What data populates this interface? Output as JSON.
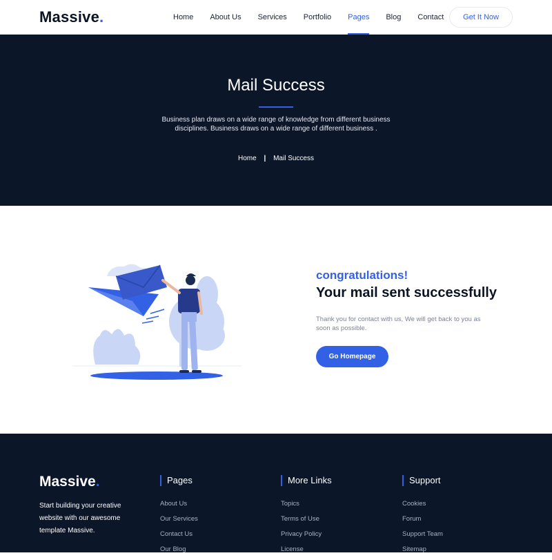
{
  "brand": {
    "name": "Massive",
    "dot": "."
  },
  "nav": {
    "items": [
      {
        "label": "Home"
      },
      {
        "label": "About Us"
      },
      {
        "label": "Services"
      },
      {
        "label": "Portfolio"
      },
      {
        "label": "Pages",
        "active": true
      },
      {
        "label": "Blog"
      },
      {
        "label": "Contact"
      }
    ],
    "cta_label": "Get It Now"
  },
  "hero": {
    "title": "Mail Success",
    "description": "Business plan draws on a wide range of knowledge from different business disciplines. Business draws on a wide range of different business .",
    "breadcrumb": {
      "home": "Home",
      "separator": "|",
      "current": "Mail Success"
    }
  },
  "main": {
    "congrats": "congratulations!",
    "headline": "Your mail sent successfully",
    "message": "Thank you for contact with us, We will get back to you as soon as possible.",
    "button_label": "Go Homepage"
  },
  "footer": {
    "tagline": "Start building your creative website with our awesome template Massive.",
    "columns": [
      {
        "title": "Pages",
        "links": [
          "About Us",
          "Our Services",
          "Contact Us",
          "Our Blog"
        ]
      },
      {
        "title": "More Links",
        "links": [
          "Topics",
          "Terms of Use",
          "Privacy Policy",
          "License"
        ]
      },
      {
        "title": "Support",
        "links": [
          "Cookies",
          "Forum",
          "Support Team",
          "Sitemap"
        ]
      }
    ]
  },
  "colors": {
    "accent": "#3361e5",
    "dark": "#0b1629",
    "light_blue": "#c9d6f5"
  }
}
